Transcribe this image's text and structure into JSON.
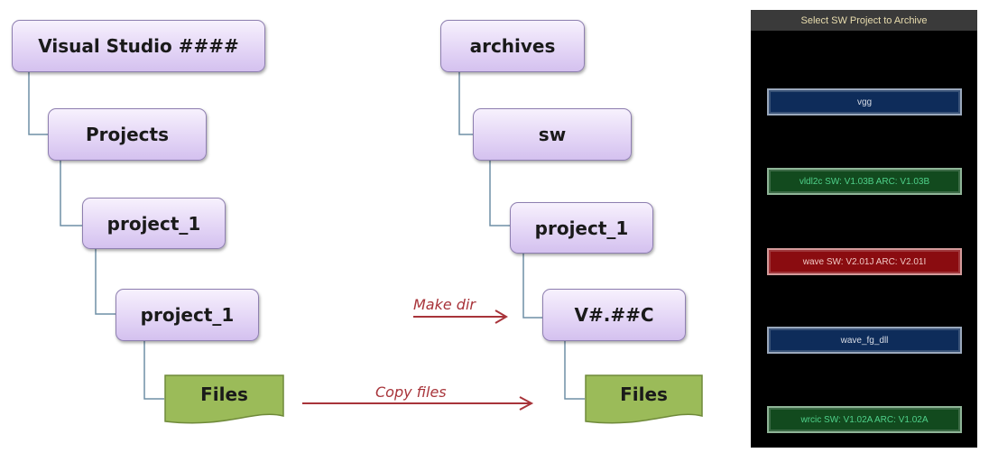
{
  "diagram": {
    "source_tree": {
      "root": "Visual Studio ####",
      "level1": "Projects",
      "level2": "project_1",
      "level3": "project_1",
      "files": "Files"
    },
    "archive_tree": {
      "root": "archives",
      "level1": "sw",
      "level2": "project_1",
      "level3": "V#.##C",
      "files": "Files"
    },
    "arrows": {
      "make_dir": "Make dir",
      "copy_files": "Copy files"
    },
    "colors": {
      "folder_fill": "#e4d6f6",
      "folder_border": "#8e7fb0",
      "files_fill": "#9bbb59",
      "connector": "#6f8fa6",
      "arrow": "#a8343a"
    }
  },
  "panel": {
    "title": "Select SW Project to Archive",
    "projects": [
      {
        "label": "vgg",
        "status": "blue"
      },
      {
        "label": "vldl2c SW: V1.03B ARC: V1.03B",
        "status": "green"
      },
      {
        "label": "wave SW: V2.01J ARC: V2.01I",
        "status": "red"
      },
      {
        "label": "wave_fg_dll",
        "status": "blue"
      },
      {
        "label": "wrcic SW: V1.02A ARC: V1.02A",
        "status": "green"
      }
    ],
    "status_colors": {
      "blue": "#0e2c5a",
      "green": "#124a1e",
      "red": "#8a0c10"
    }
  }
}
